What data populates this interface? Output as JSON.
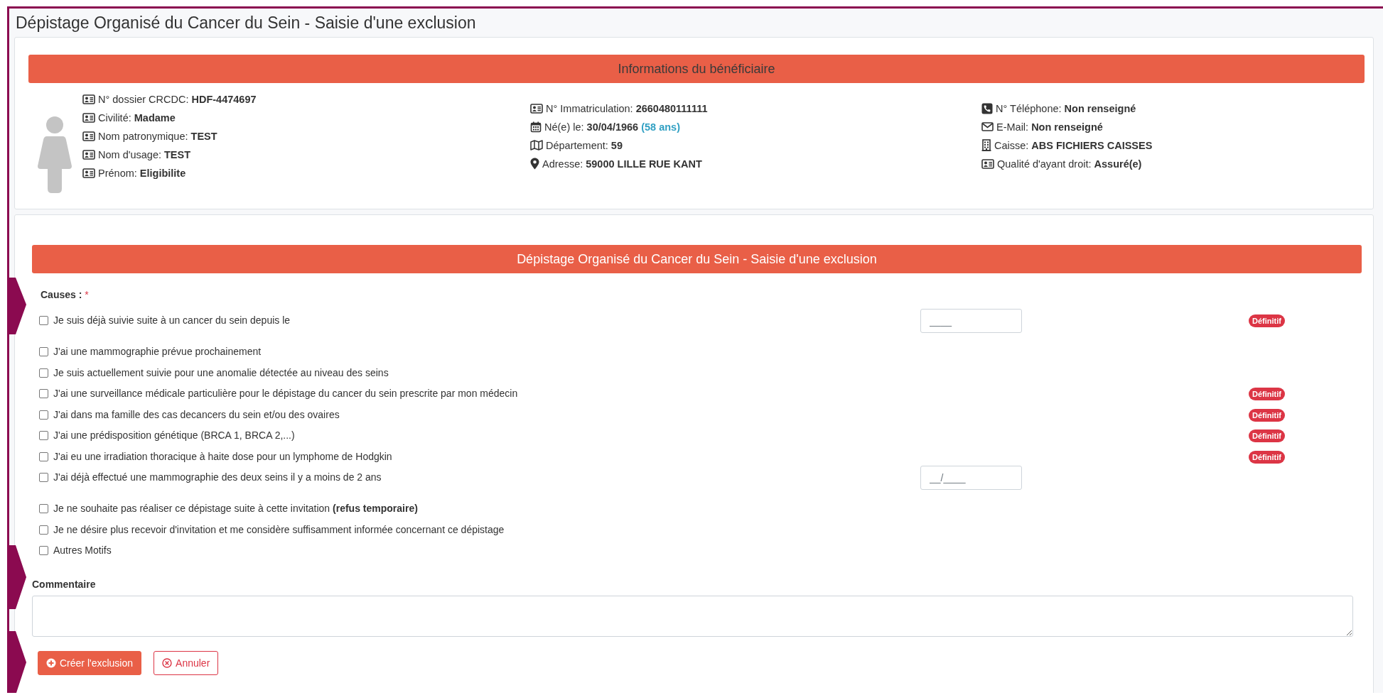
{
  "page_title": "Dépistage Organisé du Cancer du Sein - Saisie d'une exclusion",
  "beneficiary": {
    "heading": "Informations du bénéficiaire",
    "columns": [
      [
        {
          "kind": "id-card",
          "label": "N° dossier CRCDC:",
          "value": "HDF-4474697"
        },
        {
          "kind": "id-card",
          "label": "Civilité:",
          "value": "Madame"
        },
        {
          "kind": "id-card",
          "label": "Nom patronymique:",
          "value": "TEST"
        },
        {
          "kind": "id-card",
          "label": "Nom d'usage:",
          "value": "TEST"
        },
        {
          "kind": "id-card",
          "label": "Prénom:",
          "value": "Eligibilite"
        }
      ],
      [
        {
          "kind": "id-card",
          "label": "N° Immatriculation:",
          "value": "2660480111111"
        },
        {
          "kind": "calendar",
          "label": "Né(e) le:",
          "value": "30/04/1966",
          "note": "(58 ans)"
        },
        {
          "kind": "map",
          "label": "Département:",
          "value": "59"
        },
        {
          "kind": "pin",
          "label": "Adresse:",
          "value": "59000 LILLE RUE KANT"
        }
      ],
      [
        {
          "kind": "phone",
          "label": "N° Téléphone:",
          "value": "Non renseigné"
        },
        {
          "kind": "mail",
          "label": "E-Mail:",
          "value": "Non renseigné"
        },
        {
          "kind": "building",
          "label": "Caisse:",
          "value": "ABS FICHIERS CAISSES"
        },
        {
          "kind": "id-card",
          "label": "Qualité d'ayant droit:",
          "value": "Assuré(e)"
        }
      ]
    ]
  },
  "form": {
    "heading": "Dépistage Organisé du Cancer du Sein - Saisie d'une exclusion",
    "causes_label": "Causes :",
    "required_mark": "*",
    "causes": [
      {
        "label": "Je suis déjà suivie suite à un cancer du sein depuis le",
        "checked": false,
        "field": {
          "placeholder": "____"
        },
        "badge": "Définitif"
      },
      {
        "label": "J'ai une mammographie prévue prochainement",
        "checked": false
      },
      {
        "label": "Je suis actuellement suivie pour une anomalie détectée au niveau des seins",
        "checked": false
      },
      {
        "label": "J'ai une surveillance médicale particulière pour le dépistage du cancer du sein prescrite par mon médecin",
        "checked": false,
        "badge": "Définitif"
      },
      {
        "label": "J'ai dans ma famille des cas decancers du sein et/ou des ovaires",
        "checked": false,
        "badge": "Définitif"
      },
      {
        "label": "J'ai une prédisposition génétique (BRCA 1, BRCA 2,...)",
        "checked": false,
        "badge": "Définitif"
      },
      {
        "label": "J'ai eu une irradiation thoracique à haite dose pour un lymphome de Hodgkin",
        "checked": false,
        "badge": "Définitif"
      },
      {
        "label": "J'ai déjà effectué une mammographie des deux seins il y a moins de 2 ans",
        "checked": false,
        "field": {
          "placeholder": "__/____"
        }
      },
      {
        "label": "Je ne souhaite pas réaliser ce dépistage suite à cette invitation **(refus temporaire)**",
        "checked": false
      },
      {
        "label": "Je ne désire plus recevoir d'invitation et me considère suffisamment informée concernant ce dépistage",
        "checked": false
      },
      {
        "label": "Autres Motifs",
        "checked": false
      }
    ],
    "comment_label": "Commentaire",
    "buttons": [
      {
        "kind": "create",
        "label": "Créer l'exclusion"
      },
      {
        "kind": "cancel",
        "label": "Annuler"
      }
    ]
  }
}
